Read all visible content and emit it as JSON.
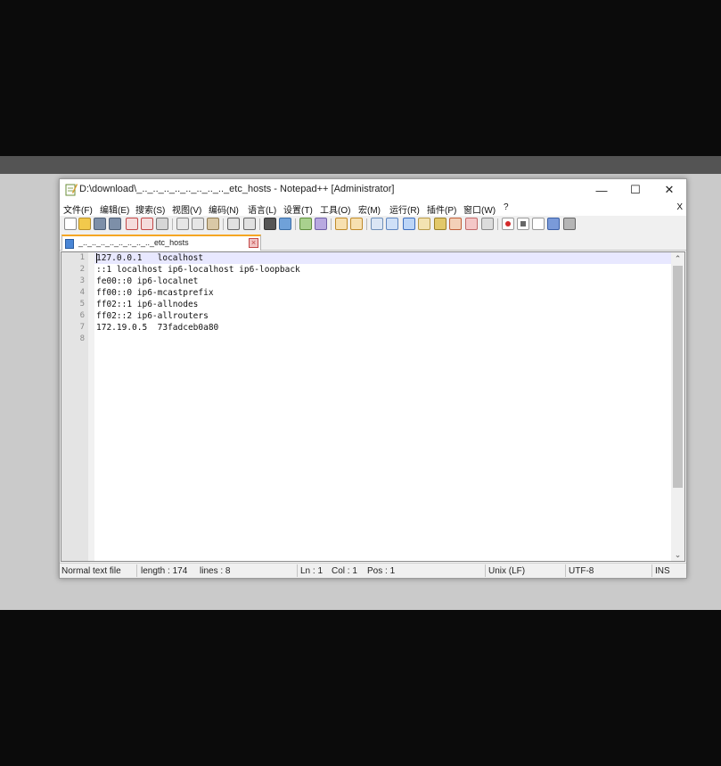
{
  "window": {
    "title": "D:\\download\\_.._.._.._.._.._.._.._.._etc_hosts - Notepad++ [Administrator]",
    "minimize": "—",
    "maximize": "☐",
    "close": "✕"
  },
  "menu": {
    "items": [
      "文件(F)",
      "编辑(E)",
      "搜索(S)",
      "视图(V)",
      "编码(N)",
      "语言(L)",
      "设置(T)",
      "工具(O)",
      "宏(M)",
      "运行(R)",
      "插件(P)",
      "窗口(W)",
      "?"
    ],
    "close": "X"
  },
  "toolbar": {
    "icons": [
      "new-file-icon",
      "open-file-icon",
      "save-icon",
      "save-all-icon",
      "close-icon",
      "close-all-icon",
      "print-icon",
      "cut-icon",
      "copy-icon",
      "paste-icon",
      "undo-icon",
      "redo-icon",
      "find-icon",
      "replace-icon",
      "zoom-in-icon",
      "zoom-out-icon",
      "sync-vertical-icon",
      "sync-horizontal-icon",
      "word-wrap-icon",
      "show-all-chars-icon",
      "indent-guide-icon",
      "user-lang-icon",
      "doc-map-icon",
      "function-list-icon",
      "folder-workspace-icon",
      "monitoring-icon",
      "record-macro-icon",
      "stop-record-icon",
      "play-macro-icon",
      "run-macro-multiple-icon",
      "save-macro-icon"
    ]
  },
  "tab": {
    "label": "_.._.._.._.._.._.._.._.._etc_hosts"
  },
  "editor": {
    "line_numbers": [
      "1",
      "2",
      "3",
      "4",
      "5",
      "6",
      "7",
      "8"
    ],
    "lines": [
      "127.0.0.1   localhost",
      "::1 localhost ip6-localhost ip6-loopback",
      "fe00::0 ip6-localnet",
      "ff00::0 ip6-mcastprefix",
      "ff02::1 ip6-allnodes",
      "ff02::2 ip6-allrouters",
      "172.19.0.5  73fadceb0a80",
      ""
    ]
  },
  "status": {
    "file_type": "Normal text file",
    "length": "length : 174",
    "lines": "lines : 8",
    "ln": "Ln : 1",
    "col": "Col : 1",
    "pos": "Pos : 1",
    "eol": "Unix (LF)",
    "encoding": "UTF-8",
    "mode": "INS"
  }
}
